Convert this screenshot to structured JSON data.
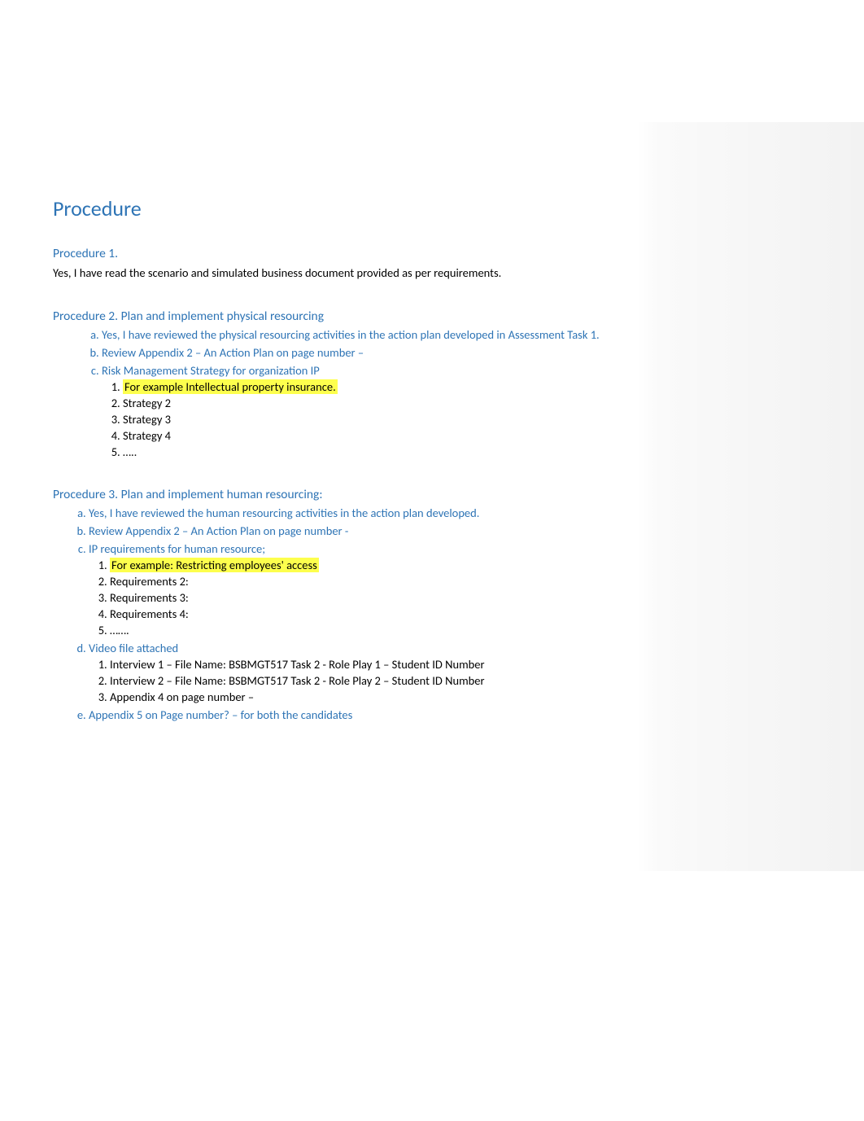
{
  "title": "Procedure",
  "p1": {
    "heading": "Procedure 1.",
    "text": "Yes, I have read the scenario and simulated business document provided as per requirements."
  },
  "p2": {
    "heading": "Procedure 2.  Plan and implement physical resourcing",
    "a": "Yes, I have reviewed the physical resourcing activities in the action plan developed in Assessment Task 1.",
    "b": "Review Appendix 2 – An Action Plan on page number –",
    "c": "Risk Management Strategy for organization IP",
    "c1": "For example Intellectual property insurance.",
    "c2": "Strategy 2",
    "c3": "Strategy 3",
    "c4": "Strategy 4",
    "c5": "….."
  },
  "p3": {
    "heading": "Procedure 3.  Plan and implement human resourcing:",
    "a": "Yes, I have reviewed the human resourcing activities in the action plan developed.",
    "b": "Review Appendix 2 – An Action Plan on page number -",
    "c": "IP requirements for human resource;",
    "c1": "For example: Restricting employees' access",
    "c2": "Requirements 2:",
    "c3": "Requirements 3:",
    "c4": "Requirements 4:",
    "c5": "…….",
    "d": "Video file attached",
    "d1": "Interview 1 – File Name: BSBMGT517 Task 2 - Role Play 1 – Student ID Number",
    "d2": "Interview 2 – File Name: BSBMGT517 Task 2 - Role Play 2 – Student ID Number",
    "d3": "Appendix 4 on page number –",
    "e": "Appendix 5 on Page number? – for both the candidates"
  }
}
